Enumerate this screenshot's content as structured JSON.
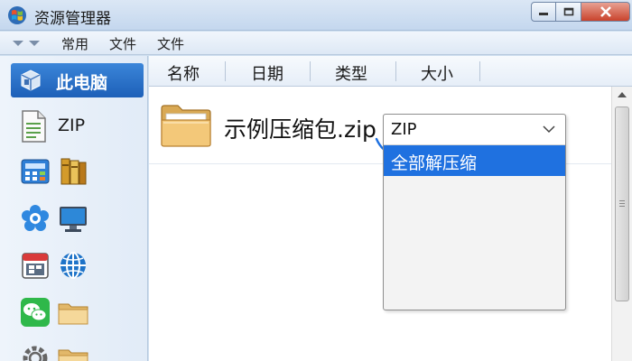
{
  "window": {
    "title": "资源管理器",
    "controls": [
      "minimize-icon",
      "maximize-icon",
      "close-icon"
    ]
  },
  "menu": {
    "items": [
      "常用",
      "文件",
      "文件"
    ]
  },
  "sidebar": {
    "selected": {
      "label": "此电脑",
      "icon": "computer-icon"
    },
    "zip": {
      "label": "ZIP",
      "icon": "document-icon"
    },
    "icon_rows": [
      [
        "calculator-icon",
        "books-icon"
      ],
      [
        "flower-icon",
        "monitor-icon"
      ],
      [
        "calendar-icon",
        "globe-icon"
      ],
      [
        "wechat-icon",
        "folder-icon"
      ],
      [
        "settings-gear-icon",
        "folder-icon"
      ]
    ]
  },
  "columns": [
    "名称",
    "日期",
    "类型",
    "大小"
  ],
  "file": {
    "name": "示例压缩包.zip",
    "icon": "folder-icon"
  },
  "dropdown": {
    "selected": "ZIP",
    "options": [
      "全部解压缩"
    ]
  },
  "colors": {
    "accent": "#1f71e0",
    "selection": "#2a72d0",
    "titlebar": "#c4d7ee",
    "close_button": "#c9432c"
  }
}
